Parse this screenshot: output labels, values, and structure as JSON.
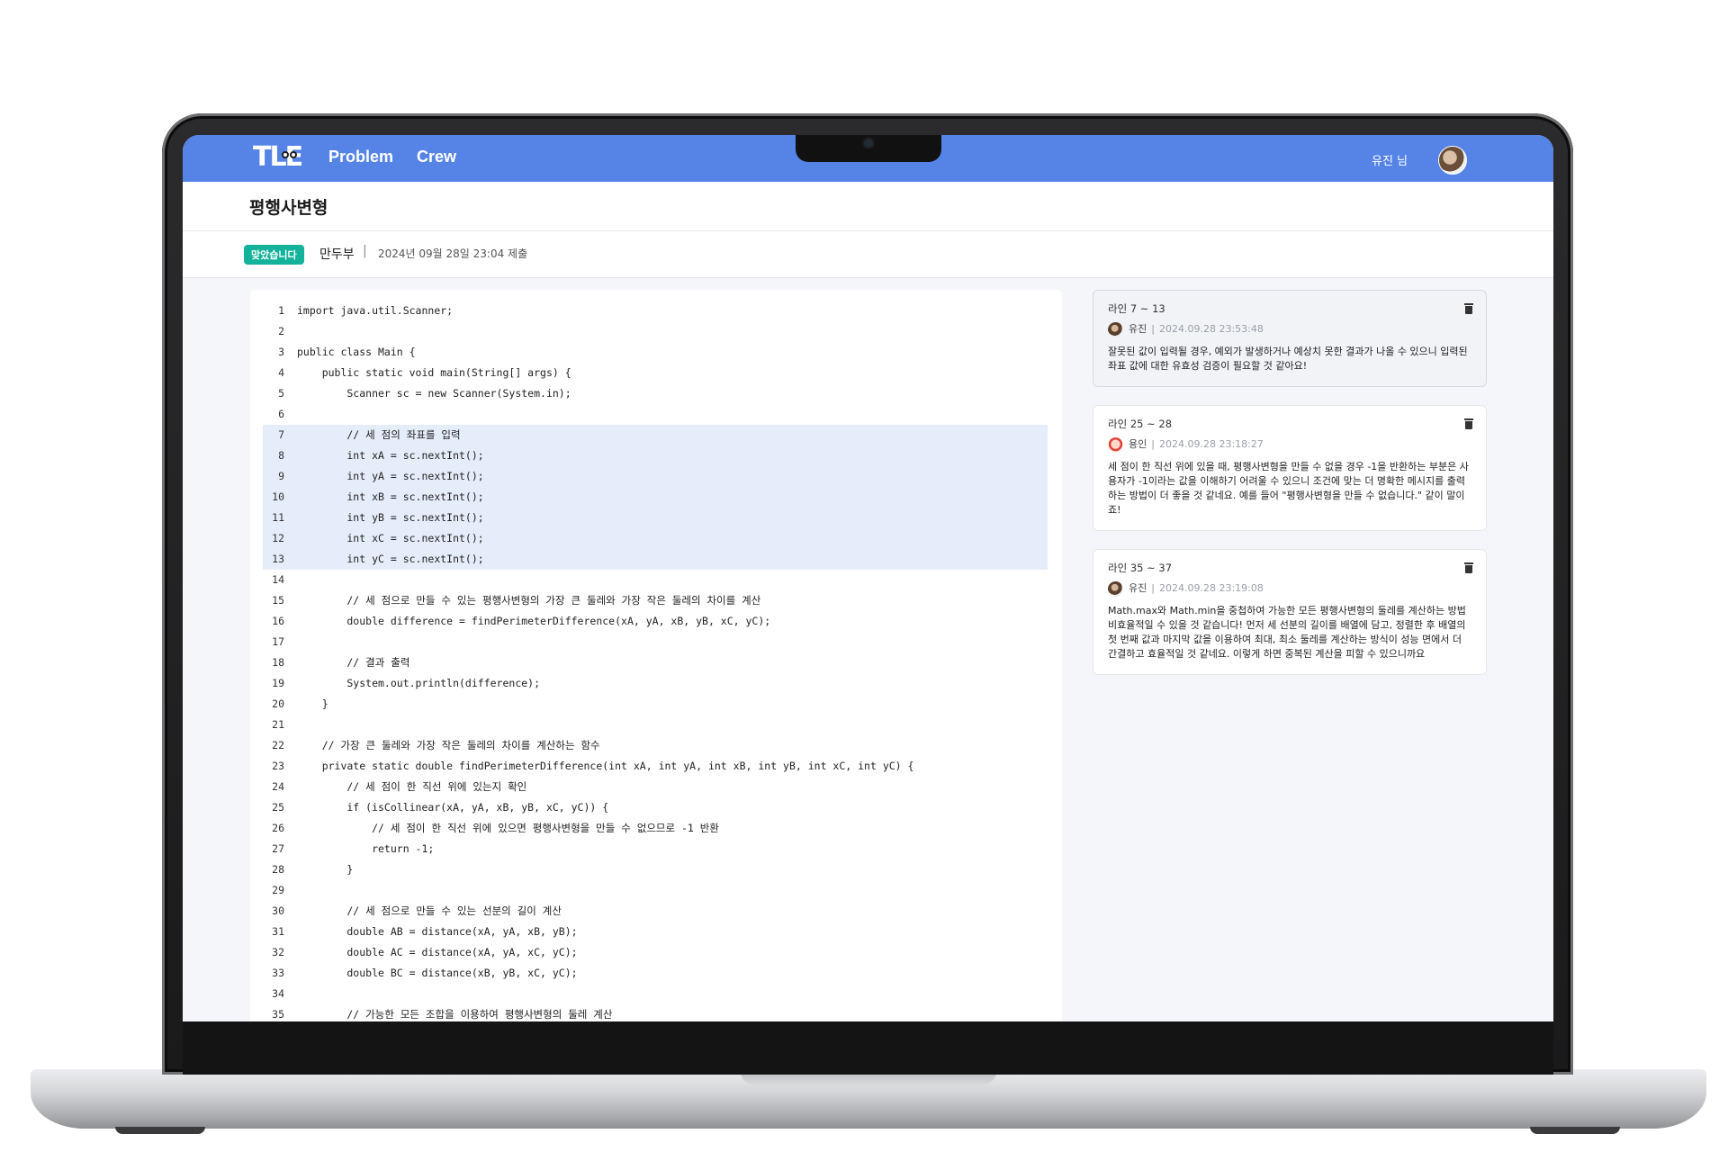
{
  "nav": {
    "logo": "TLE",
    "links": [
      "Problem",
      "Crew"
    ],
    "user_greeting": "유진 님"
  },
  "problem": {
    "title": "평행사변형",
    "status": "맞았습니다",
    "author": "만두부",
    "separator": "|",
    "submitted_at": "2024년 09월 28일 23:04 제출"
  },
  "code": {
    "highlight_start": 7,
    "highlight_end": 13,
    "lines": [
      {
        "n": "1",
        "text": "import java.util.Scanner;"
      },
      {
        "n": "2",
        "text": ""
      },
      {
        "n": "3",
        "text": "public class Main {"
      },
      {
        "n": "4",
        "text": "    public static void main(String[] args) {"
      },
      {
        "n": "5",
        "text": "        Scanner sc = new Scanner(System.in);"
      },
      {
        "n": "6",
        "text": ""
      },
      {
        "n": "7",
        "text": "        // 세 점의 좌표를 입력"
      },
      {
        "n": "8",
        "text": "        int xA = sc.nextInt();"
      },
      {
        "n": "9",
        "text": "        int yA = sc.nextInt();"
      },
      {
        "n": "10",
        "text": "        int xB = sc.nextInt();"
      },
      {
        "n": "11",
        "text": "        int yB = sc.nextInt();"
      },
      {
        "n": "12",
        "text": "        int xC = sc.nextInt();"
      },
      {
        "n": "13",
        "text": "        int yC = sc.nextInt();"
      },
      {
        "n": "14",
        "text": ""
      },
      {
        "n": "15",
        "text": "        // 세 점으로 만들 수 있는 평행사변형의 가장 큰 둘레와 가장 작은 둘레의 차이를 계산"
      },
      {
        "n": "16",
        "text": "        double difference = findPerimeterDifference(xA, yA, xB, yB, xC, yC);"
      },
      {
        "n": "17",
        "text": ""
      },
      {
        "n": "18",
        "text": "        // 결과 출력"
      },
      {
        "n": "19",
        "text": "        System.out.println(difference);"
      },
      {
        "n": "20",
        "text": "    }"
      },
      {
        "n": "21",
        "text": ""
      },
      {
        "n": "22",
        "text": "    // 가장 큰 둘레와 가장 작은 둘레의 차이를 계산하는 함수"
      },
      {
        "n": "23",
        "text": "    private static double findPerimeterDifference(int xA, int yA, int xB, int yB, int xC, int yC) {"
      },
      {
        "n": "24",
        "text": "        // 세 점이 한 직선 위에 있는지 확인"
      },
      {
        "n": "25",
        "text": "        if (isCollinear(xA, yA, xB, yB, xC, yC)) {"
      },
      {
        "n": "26",
        "text": "            // 세 점이 한 직선 위에 있으면 평행사변형을 만들 수 없으므로 -1 반환"
      },
      {
        "n": "27",
        "text": "            return -1;"
      },
      {
        "n": "28",
        "text": "        }"
      },
      {
        "n": "29",
        "text": ""
      },
      {
        "n": "30",
        "text": "        // 세 점으로 만들 수 있는 선분의 길이 계산"
      },
      {
        "n": "31",
        "text": "        double AB = distance(xA, yA, xB, yB);"
      },
      {
        "n": "32",
        "text": "        double AC = distance(xA, yA, xC, yC);"
      },
      {
        "n": "33",
        "text": "        double BC = distance(xB, yB, xC, yC);"
      },
      {
        "n": "34",
        "text": ""
      },
      {
        "n": "35",
        "text": "        // 가능한 모든 조합을 이용하여 평행사변형의 둘레 계산"
      }
    ]
  },
  "comments": [
    {
      "range": "라인 7 ~ 13",
      "user": "유진",
      "sep": "|",
      "time": "2024.09.28 23:53:48",
      "avatar": "photo-avatar",
      "body": "잘못된 값이 입력될 경우, 예외가 발생하거나 예상치 못한 결과가 나올 수 있으니 입력된 좌표 값에 대한 유효성 검증이 필요할 것 같아요!"
    },
    {
      "range": "라인 25 ~ 28",
      "user": "용인",
      "sep": "|",
      "time": "2024.09.28 23:18:27",
      "avatar": "red-avatar",
      "body": "세 점이 한 직선 위에 있을 때, 평행사변형을 만들 수 없을 경우 -1을 반환하는 부분은 사용자가 -1이라는 값을 이해하기 어려울 수 있으니 조건에 맞는 더 명확한 메시지를 출력하는 방법이 더 좋을 것 같네요. 예를 들어 \"평행사변형을 만들 수 없습니다.\" 같이 말이죠!"
    },
    {
      "range": "라인 35 ~ 37",
      "user": "유진",
      "sep": "|",
      "time": "2024.09.28 23:19:08",
      "avatar": "photo-avatar",
      "body": "Math.max와 Math.min을 중첩하여 가능한 모든 평행사변형의 둘레를 계산하는 방법 비효율적일 수 있을 것 같습니다! 먼저 세 선분의 길이를 배열에 담고, 정렬한 후 배열의 첫 번째 값과 마지막 값을 이용하여 최대, 최소 둘레를 계산하는 방식이 성능 면에서 더 간결하고 효율적일 것 같네요. 이렇게 하면 중복된 계산을 피할 수 있으니까요"
    }
  ]
}
